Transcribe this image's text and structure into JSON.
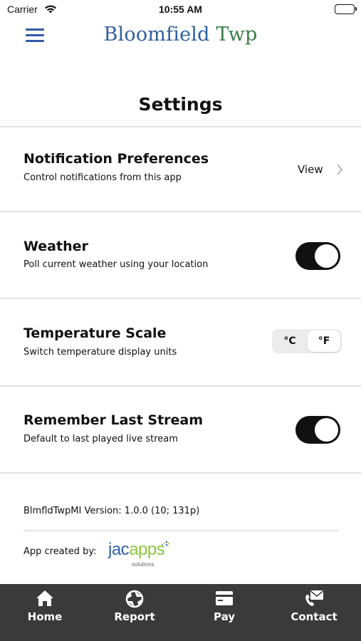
{
  "status_bar": {
    "carrier": "Carrier",
    "time": "10:55 AM"
  },
  "header": {
    "logo_part1": "Bloomfield",
    "logo_part2": " Twp",
    "menu_icon": "hamburger-menu-icon"
  },
  "page_title": "Settings",
  "settings": {
    "notifications": {
      "title": "Notification Preferences",
      "subtitle": "Control notifications from this app",
      "action_label": "View"
    },
    "weather": {
      "title": "Weather",
      "subtitle": "Poll current weather using your location",
      "enabled": true
    },
    "temperature": {
      "title": "Temperature Scale",
      "subtitle": "Switch temperature display units",
      "option_c": "°C",
      "option_f": "°F",
      "selected": "°F"
    },
    "remember_stream": {
      "title": "Remember Last Stream",
      "subtitle": "Default to last played live stream",
      "enabled": true
    }
  },
  "footer": {
    "version": "BlmfldTwpMI Version: 1.0.0 (10; 131p)",
    "created_by": "App created by:",
    "brand_jac": "jac",
    "brand_apps": "apps",
    "brand_sub": "solutions"
  },
  "tab_bar": {
    "tabs": [
      {
        "label": "Home",
        "icon": "home-icon"
      },
      {
        "label": "Report",
        "icon": "report-icon"
      },
      {
        "label": "Pay",
        "icon": "pay-icon"
      },
      {
        "label": "Contact",
        "icon": "contact-icon"
      }
    ]
  },
  "colors": {
    "brand_blue": "#2f59a8",
    "brand_green": "#3b7d46",
    "tab_bar_bg": "#3a3a3a",
    "toggle_on": "#111111"
  }
}
